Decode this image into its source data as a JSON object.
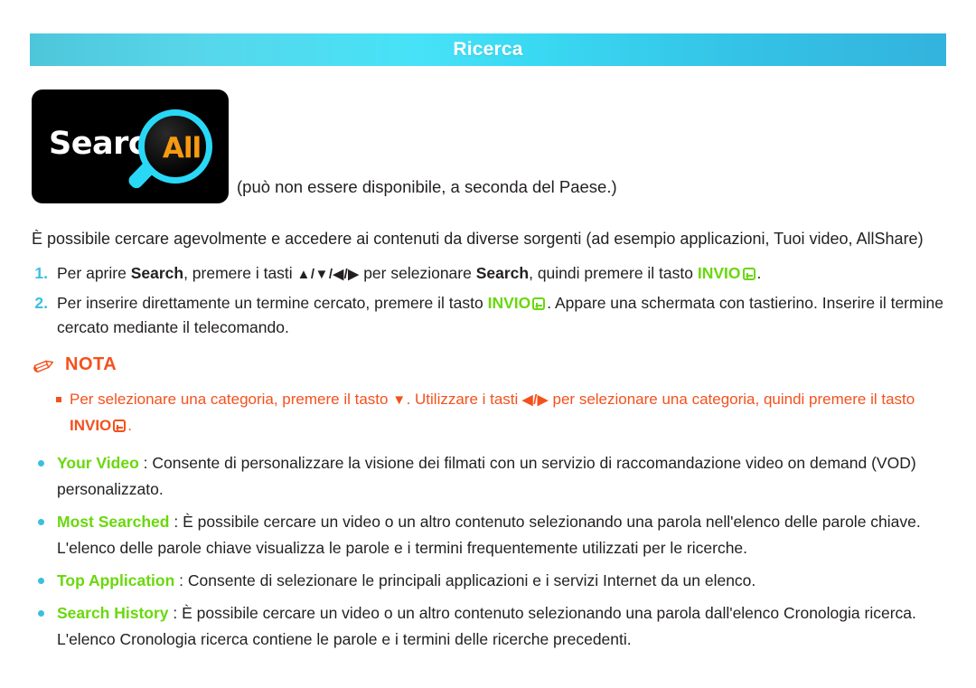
{
  "banner": {
    "title": "Ricerca",
    "gradient_start": "#4ec6da",
    "gradient_mid": "#47e2f7",
    "gradient_end": "#33b3dd"
  },
  "logo": {
    "word": "Search",
    "badge": "All",
    "icon": "magnifier-icon",
    "word_color": "#ffffff",
    "badge_color": "#f59a11",
    "ring_color": "#29d8f7",
    "background": "#000000"
  },
  "caption": "(può non essere disponibile, a seconda del Paese.)",
  "intro": "È possibile cercare agevolmente e accedere ai contenuti da diverse sorgenti (ad esempio applicazioni, Tuoi video, AllShare)",
  "steps": [
    {
      "number": "1.",
      "p1": "Per aprire ",
      "b1": "Search",
      "p2": ", premere i tasti ",
      "arrows": "▲/▼/◀/▶",
      "p3": " per selezionare ",
      "b2": "Search",
      "p4": ", quindi premere il tasto ",
      "key": "INVIO",
      "p5": "."
    },
    {
      "number": "2.",
      "p1": "Per inserire direttamente un termine cercato, premere il tasto ",
      "key": "INVIO",
      "p2": ". Appare una schermata con tastierino. Inserire il termine cercato mediante il telecomando."
    }
  ],
  "nota": {
    "icon": "pencil-icon",
    "label": "NOTA",
    "color": "#f4511e",
    "items": [
      {
        "p1": "Per selezionare una categoria, premere il tasto ",
        "arrow1": "▼",
        "p2": ". Utilizzare i tasti ",
        "arrows": "◀/▶",
        "p3": " per selezionare una categoria, quindi premere il tasto ",
        "key": "INVIO",
        "p4": "."
      }
    ]
  },
  "features": [
    {
      "name": "Your Video",
      "separator": " : ",
      "description": "Consente di personalizzare la visione dei filmati con un servizio di raccomandazione video on demand (VOD) personalizzato."
    },
    {
      "name": "Most Searched",
      "separator": " : ",
      "description": "È possibile cercare un video o un altro contenuto selezionando una parola nell'elenco delle parole chiave. L'elenco delle parole chiave visualizza le parole e i termini frequentemente utilizzati per le ricerche."
    },
    {
      "name": "Top Application",
      "separator": " : ",
      "description": "Consente di selezionare le principali applicazioni e i servizi Internet da un elenco."
    },
    {
      "name": "Search History",
      "separator": " : ",
      "description": "È possibile cercare un video o un altro contenuto selezionando una parola dall'elenco Cronologia ricerca. L'elenco Cronologia ricerca contiene le parole e i termini delle ricerche precedenti."
    }
  ],
  "colors": {
    "accent_cyan": "#3bbfe0",
    "accent_green": "#69d80b",
    "accent_orange": "#f4511e",
    "text": "#231f20"
  }
}
